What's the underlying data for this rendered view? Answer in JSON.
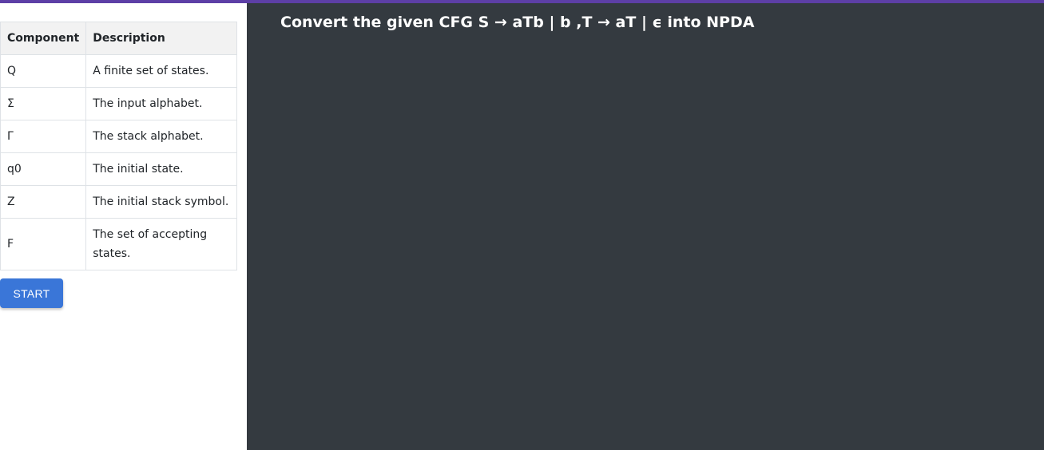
{
  "colors": {
    "top_bar": "#5d3fa6",
    "workspace_bg": "#343a40",
    "start_button_bg": "#3a76d8",
    "table_header_bg": "#f2f2f2"
  },
  "table": {
    "headers": [
      "Component",
      "Description"
    ],
    "rows": [
      {
        "component": "Q",
        "description": "A finite set of states."
      },
      {
        "component": "Σ",
        "description": "The input alphabet."
      },
      {
        "component": "Γ",
        "description": "The stack alphabet."
      },
      {
        "component": "q0",
        "description": "The initial state."
      },
      {
        "component": "Z",
        "description": "The initial stack symbol."
      },
      {
        "component": "F",
        "description": "The set of accepting states."
      }
    ]
  },
  "controls": {
    "start_label": "START"
  },
  "workspace": {
    "title": "Convert the given CFG S → aTb | b ,T → aT | ϵ into NPDA"
  }
}
